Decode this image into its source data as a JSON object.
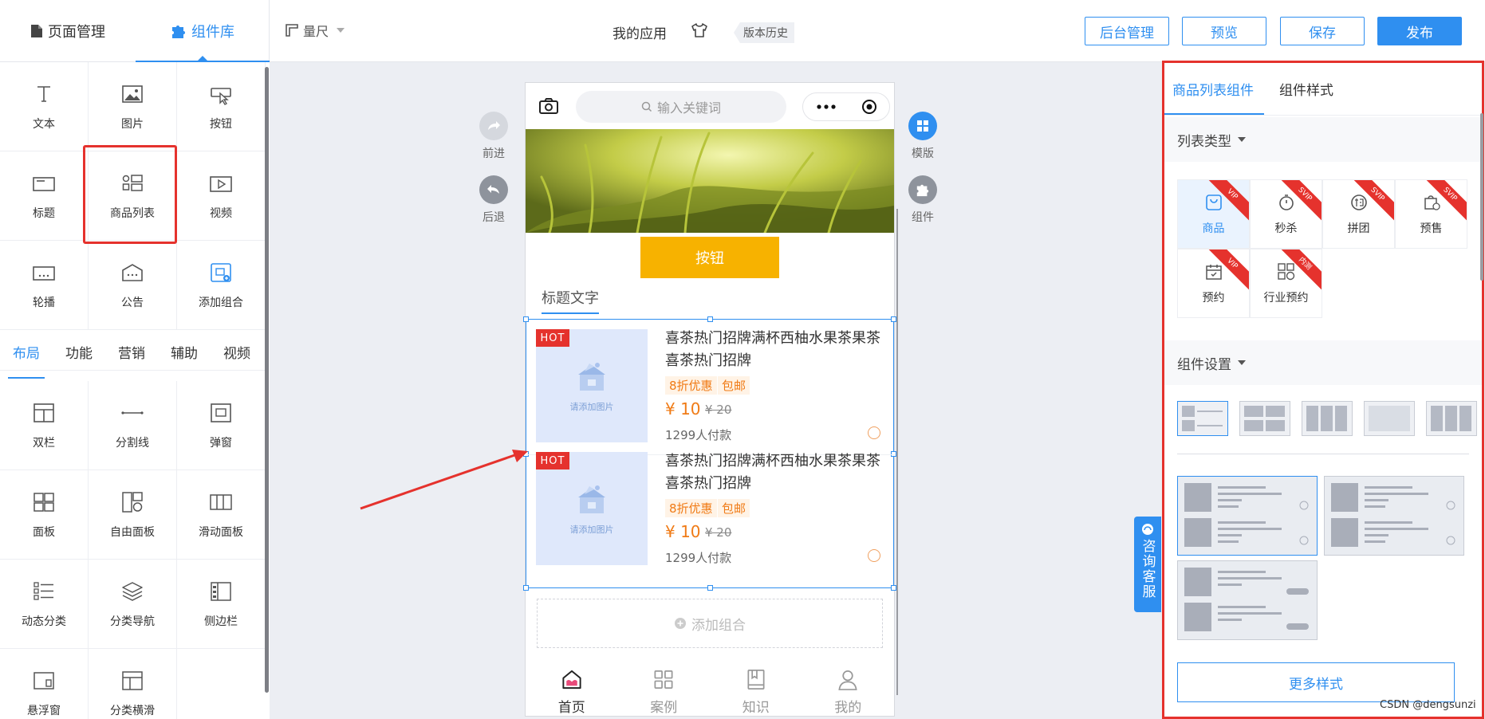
{
  "topbar": {
    "tab_pages": "页面管理",
    "tab_components": "组件库",
    "ruler": "量尺",
    "app_name": "我的应用",
    "version_history": "版本历史",
    "btn_admin": "后台管理",
    "btn_preview": "预览",
    "btn_save": "保存",
    "btn_publish": "发布"
  },
  "components": {
    "basic": [
      {
        "label": "文本",
        "icon": "text-icon"
      },
      {
        "label": "图片",
        "icon": "image-icon"
      },
      {
        "label": "按钮",
        "icon": "button-icon"
      },
      {
        "label": "标题",
        "icon": "title-icon"
      },
      {
        "label": "商品列表",
        "icon": "product-list-icon"
      },
      {
        "label": "视频",
        "icon": "video-icon"
      },
      {
        "label": "轮播",
        "icon": "carousel-icon"
      },
      {
        "label": "公告",
        "icon": "notice-icon"
      },
      {
        "label": "添加组合",
        "icon": "add-combo-icon"
      }
    ],
    "subtabs": [
      "布局",
      "功能",
      "营销",
      "辅助",
      "视频"
    ],
    "layout": [
      {
        "label": "双栏",
        "icon": "two-column-icon"
      },
      {
        "label": "分割线",
        "icon": "divider-icon"
      },
      {
        "label": "弹窗",
        "icon": "popup-icon"
      },
      {
        "label": "面板",
        "icon": "panel-icon"
      },
      {
        "label": "自由面板",
        "icon": "free-panel-icon"
      },
      {
        "label": "滑动面板",
        "icon": "slide-panel-icon"
      },
      {
        "label": "动态分类",
        "icon": "dynamic-category-icon"
      },
      {
        "label": "分类导航",
        "icon": "category-nav-icon"
      },
      {
        "label": "侧边栏",
        "icon": "sidebar-icon"
      },
      {
        "label": "悬浮窗",
        "icon": "float-window-icon"
      },
      {
        "label": "分类横滑",
        "icon": "category-scroll-icon"
      }
    ]
  },
  "canvas": {
    "forward": "前进",
    "back": "后退",
    "template": "模版",
    "component": "组件",
    "search_placeholder": "输入关键词",
    "button_text": "按钮",
    "title_text": "标题文字",
    "products": [
      {
        "badge": "HOT",
        "img_placeholder": "请添加图片",
        "name": "喜茶热门招牌满杯西柚水果茶果茶喜茶热门招牌",
        "tag1": "8折优惠",
        "tag2": "包邮",
        "price": "¥ 10",
        "old_price": "¥ 20",
        "paid": "1299人付款"
      },
      {
        "badge": "HOT",
        "img_placeholder": "请添加图片",
        "name": "喜茶热门招牌满杯西柚水果茶果茶喜茶热门招牌",
        "tag1": "8折优惠",
        "tag2": "包邮",
        "price": "¥ 10",
        "old_price": "¥ 20",
        "paid": "1299人付款"
      }
    ],
    "add_group": "添加组合",
    "tabbar": [
      "首页",
      "案例",
      "知识",
      "我的"
    ]
  },
  "right": {
    "tab_list": "商品列表组件",
    "tab_style": "组件样式",
    "list_type": "列表类型",
    "list_types": [
      {
        "label": "商品",
        "ribbon": "VIP"
      },
      {
        "label": "秒杀",
        "ribbon": "SVIP"
      },
      {
        "label": "拼团",
        "ribbon": "SVIP"
      },
      {
        "label": "预售",
        "ribbon": "SVIP"
      },
      {
        "label": "预约",
        "ribbon": "VIP"
      },
      {
        "label": "行业预约",
        "ribbon": "内测"
      }
    ],
    "component_settings": "组件设置",
    "more_styles": "更多样式",
    "consult": "咨询客服"
  },
  "watermark": "CSDN @dengsunzi",
  "colors": {
    "accent": "#2f8ff0",
    "highlight": "#e5322d",
    "button": "#f7b200"
  }
}
